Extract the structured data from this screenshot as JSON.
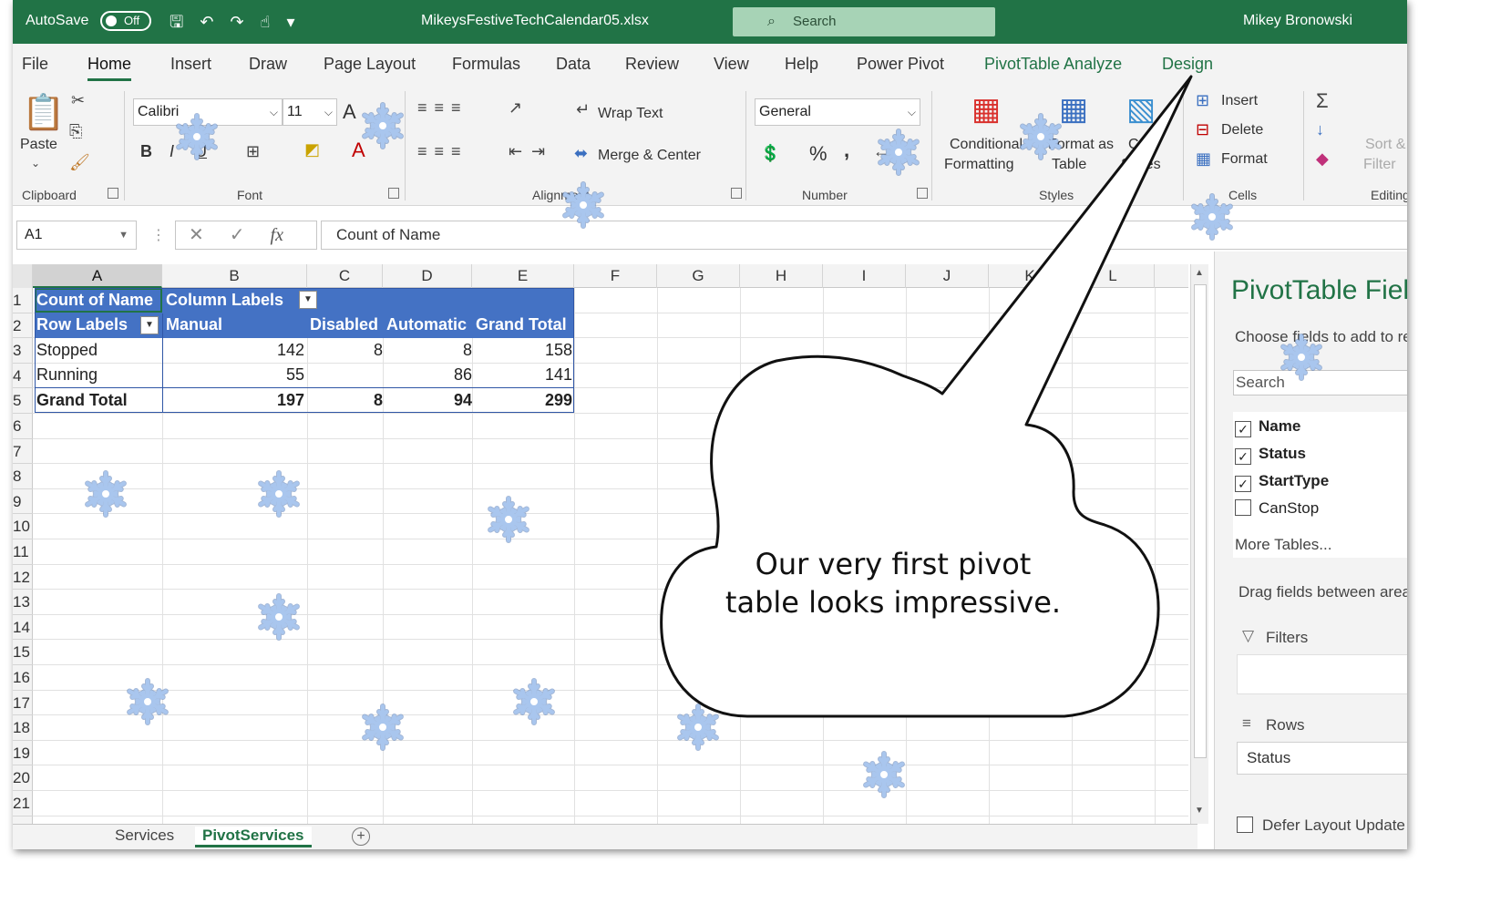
{
  "title_bar": {
    "autosave_label": "AutoSave",
    "autosave_state": "Off",
    "filename": "MikeysFestiveTechCalendar05.xlsx",
    "search_placeholder": "Search",
    "user_name": "Mikey Bronowski"
  },
  "tabs": [
    "File",
    "Home",
    "Insert",
    "Draw",
    "Page Layout",
    "Formulas",
    "Data",
    "Review",
    "View",
    "Help",
    "Power Pivot",
    "PivotTable Analyze",
    "Design"
  ],
  "active_tab": "Home",
  "ribbon": {
    "clipboard": {
      "paste_label": "Paste",
      "group_label": "Clipboard"
    },
    "font": {
      "font_name": "Calibri",
      "font_size": "11",
      "group_label": "Font",
      "bold": "B",
      "italic": "I",
      "underline": "U",
      "grow": "A"
    },
    "alignment": {
      "wrap_text": "Wrap Text",
      "merge_center": "Merge & Center",
      "group_label": "Alignment"
    },
    "number": {
      "format": "General",
      "percent": "%",
      "comma": ",",
      "group_label": "Number"
    },
    "styles": {
      "conditional_formatting_1": "Conditional",
      "conditional_formatting_2": "Formatting",
      "format_as_table_1": "Format as",
      "format_as_table_2": "Table",
      "cell_styles_1": "Cell",
      "cell_styles_2": "Styles",
      "group_label": "Styles"
    },
    "cells": {
      "insert": "Insert",
      "delete": "Delete",
      "format": "Format",
      "group_label": "Cells"
    },
    "editing": {
      "sort_1": "Sort &",
      "sort_2": "Filter",
      "group_label": "Editing"
    }
  },
  "formula_bar": {
    "name_box": "A1",
    "fx": "fx",
    "content": "Count of Name"
  },
  "columns": [
    "A",
    "B",
    "C",
    "D",
    "E",
    "F",
    "G",
    "H",
    "I",
    "J",
    "K",
    "L"
  ],
  "rows": [
    "1",
    "2",
    "3",
    "4",
    "5",
    "6",
    "7",
    "8",
    "9",
    "10",
    "11",
    "12",
    "13",
    "14",
    "15",
    "16",
    "17",
    "18",
    "19",
    "20",
    "21"
  ],
  "pivot": {
    "count_label": "Count of Name",
    "column_labels": "Column Labels",
    "row_labels": "Row Labels",
    "col_headers": [
      "Manual",
      "Disabled",
      "Automatic",
      "Grand Total"
    ],
    "rows": [
      {
        "label": "Stopped",
        "manual": "142",
        "disabled": "8",
        "automatic": "8",
        "total": "158"
      },
      {
        "label": "Running",
        "manual": "55",
        "disabled": "",
        "automatic": "86",
        "total": "141"
      }
    ],
    "grand_total": {
      "label": "Grand Total",
      "manual": "197",
      "disabled": "8",
      "automatic": "94",
      "total": "299"
    }
  },
  "sheet_tabs": [
    "Services",
    "PivotServices"
  ],
  "active_sheet": "PivotServices",
  "pivot_pane": {
    "title": "PivotTable Fields",
    "choose_text": "Choose fields to add to report:",
    "search_placeholder": "Search",
    "fields": [
      {
        "name": "Name",
        "checked": true
      },
      {
        "name": "Status",
        "checked": true
      },
      {
        "name": "StartType",
        "checked": true
      },
      {
        "name": "CanStop",
        "checked": false
      }
    ],
    "more_tables": "More Tables...",
    "drag_text": "Drag fields between areas below:",
    "filters_label": "Filters",
    "rows_label": "Rows",
    "rows_value": "Status",
    "defer_label": "Defer Layout Update"
  },
  "callout": {
    "line1": "Our very first pivot",
    "line2": "table looks impressive."
  },
  "colors": {
    "excel_green": "#217346",
    "pivot_header": "#4472c4",
    "snowflake": "#a9c6ee"
  }
}
